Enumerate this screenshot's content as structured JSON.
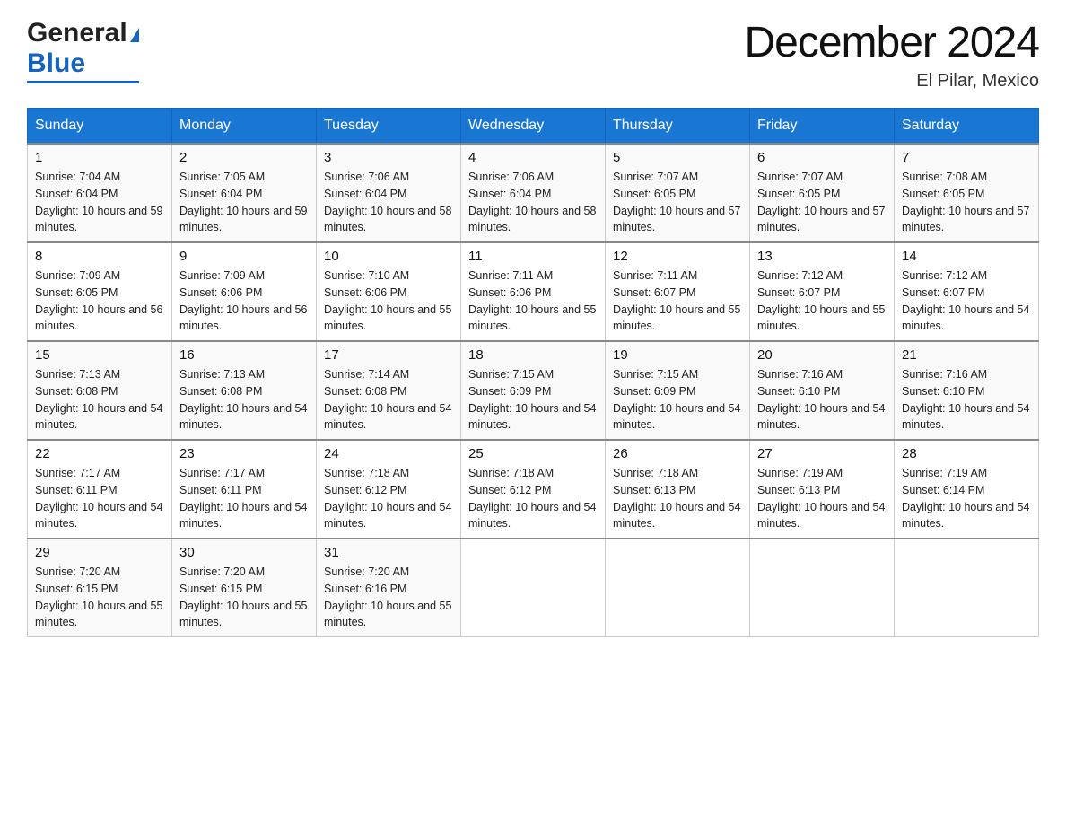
{
  "header": {
    "logo": {
      "general": "General",
      "blue": "Blue",
      "triangle": "▲"
    },
    "title": "December 2024",
    "location": "El Pilar, Mexico"
  },
  "calendar": {
    "days_of_week": [
      "Sunday",
      "Monday",
      "Tuesday",
      "Wednesday",
      "Thursday",
      "Friday",
      "Saturday"
    ],
    "weeks": [
      [
        {
          "day": "1",
          "sunrise": "7:04 AM",
          "sunset": "6:04 PM",
          "daylight": "10 hours and 59 minutes."
        },
        {
          "day": "2",
          "sunrise": "7:05 AM",
          "sunset": "6:04 PM",
          "daylight": "10 hours and 59 minutes."
        },
        {
          "day": "3",
          "sunrise": "7:06 AM",
          "sunset": "6:04 PM",
          "daylight": "10 hours and 58 minutes."
        },
        {
          "day": "4",
          "sunrise": "7:06 AM",
          "sunset": "6:04 PM",
          "daylight": "10 hours and 58 minutes."
        },
        {
          "day": "5",
          "sunrise": "7:07 AM",
          "sunset": "6:05 PM",
          "daylight": "10 hours and 57 minutes."
        },
        {
          "day": "6",
          "sunrise": "7:07 AM",
          "sunset": "6:05 PM",
          "daylight": "10 hours and 57 minutes."
        },
        {
          "day": "7",
          "sunrise": "7:08 AM",
          "sunset": "6:05 PM",
          "daylight": "10 hours and 57 minutes."
        }
      ],
      [
        {
          "day": "8",
          "sunrise": "7:09 AM",
          "sunset": "6:05 PM",
          "daylight": "10 hours and 56 minutes."
        },
        {
          "day": "9",
          "sunrise": "7:09 AM",
          "sunset": "6:06 PM",
          "daylight": "10 hours and 56 minutes."
        },
        {
          "day": "10",
          "sunrise": "7:10 AM",
          "sunset": "6:06 PM",
          "daylight": "10 hours and 55 minutes."
        },
        {
          "day": "11",
          "sunrise": "7:11 AM",
          "sunset": "6:06 PM",
          "daylight": "10 hours and 55 minutes."
        },
        {
          "day": "12",
          "sunrise": "7:11 AM",
          "sunset": "6:07 PM",
          "daylight": "10 hours and 55 minutes."
        },
        {
          "day": "13",
          "sunrise": "7:12 AM",
          "sunset": "6:07 PM",
          "daylight": "10 hours and 55 minutes."
        },
        {
          "day": "14",
          "sunrise": "7:12 AM",
          "sunset": "6:07 PM",
          "daylight": "10 hours and 54 minutes."
        }
      ],
      [
        {
          "day": "15",
          "sunrise": "7:13 AM",
          "sunset": "6:08 PM",
          "daylight": "10 hours and 54 minutes."
        },
        {
          "day": "16",
          "sunrise": "7:13 AM",
          "sunset": "6:08 PM",
          "daylight": "10 hours and 54 minutes."
        },
        {
          "day": "17",
          "sunrise": "7:14 AM",
          "sunset": "6:08 PM",
          "daylight": "10 hours and 54 minutes."
        },
        {
          "day": "18",
          "sunrise": "7:15 AM",
          "sunset": "6:09 PM",
          "daylight": "10 hours and 54 minutes."
        },
        {
          "day": "19",
          "sunrise": "7:15 AM",
          "sunset": "6:09 PM",
          "daylight": "10 hours and 54 minutes."
        },
        {
          "day": "20",
          "sunrise": "7:16 AM",
          "sunset": "6:10 PM",
          "daylight": "10 hours and 54 minutes."
        },
        {
          "day": "21",
          "sunrise": "7:16 AM",
          "sunset": "6:10 PM",
          "daylight": "10 hours and 54 minutes."
        }
      ],
      [
        {
          "day": "22",
          "sunrise": "7:17 AM",
          "sunset": "6:11 PM",
          "daylight": "10 hours and 54 minutes."
        },
        {
          "day": "23",
          "sunrise": "7:17 AM",
          "sunset": "6:11 PM",
          "daylight": "10 hours and 54 minutes."
        },
        {
          "day": "24",
          "sunrise": "7:18 AM",
          "sunset": "6:12 PM",
          "daylight": "10 hours and 54 minutes."
        },
        {
          "day": "25",
          "sunrise": "7:18 AM",
          "sunset": "6:12 PM",
          "daylight": "10 hours and 54 minutes."
        },
        {
          "day": "26",
          "sunrise": "7:18 AM",
          "sunset": "6:13 PM",
          "daylight": "10 hours and 54 minutes."
        },
        {
          "day": "27",
          "sunrise": "7:19 AM",
          "sunset": "6:13 PM",
          "daylight": "10 hours and 54 minutes."
        },
        {
          "day": "28",
          "sunrise": "7:19 AM",
          "sunset": "6:14 PM",
          "daylight": "10 hours and 54 minutes."
        }
      ],
      [
        {
          "day": "29",
          "sunrise": "7:20 AM",
          "sunset": "6:15 PM",
          "daylight": "10 hours and 55 minutes."
        },
        {
          "day": "30",
          "sunrise": "7:20 AM",
          "sunset": "6:15 PM",
          "daylight": "10 hours and 55 minutes."
        },
        {
          "day": "31",
          "sunrise": "7:20 AM",
          "sunset": "6:16 PM",
          "daylight": "10 hours and 55 minutes."
        },
        null,
        null,
        null,
        null
      ]
    ]
  }
}
